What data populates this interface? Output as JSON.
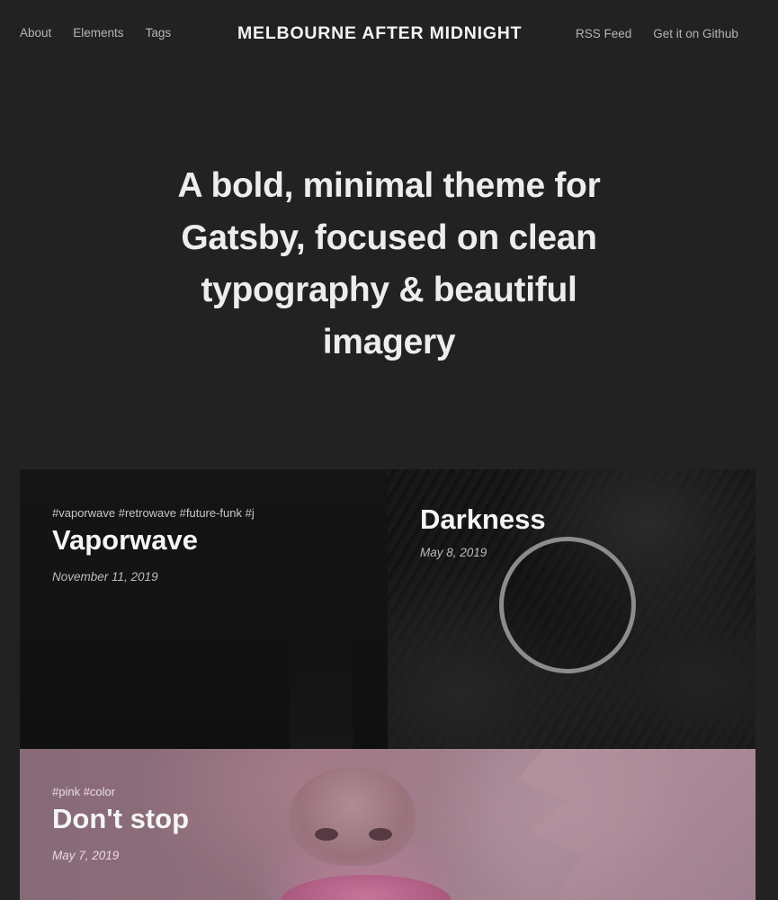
{
  "header": {
    "nav_left": [
      {
        "label": "About"
      },
      {
        "label": "Elements"
      },
      {
        "label": "Tags"
      }
    ],
    "site_title": "MELBOURNE AFTER MIDNIGHT",
    "nav_right": [
      {
        "label": "RSS Feed"
      },
      {
        "label": "Get it on Github"
      }
    ]
  },
  "hero": {
    "headline": "A bold, minimal theme for Gatsby, focused on clean typography & beautiful imagery"
  },
  "posts": [
    {
      "tags": "#vaporwave #retrowave #future-funk #j",
      "title": "Vaporwave",
      "date": "November 11, 2019"
    },
    {
      "tags": "",
      "title": "Darkness",
      "date": "May 8, 2019"
    },
    {
      "tags": "#pink #color",
      "title": "Don't stop",
      "date": "May 7, 2019"
    }
  ],
  "colors": {
    "background": "#222222",
    "text_primary": "#f2f2f2",
    "text_muted": "#b5b5b5",
    "loader_ring": "#8c8c8c"
  }
}
